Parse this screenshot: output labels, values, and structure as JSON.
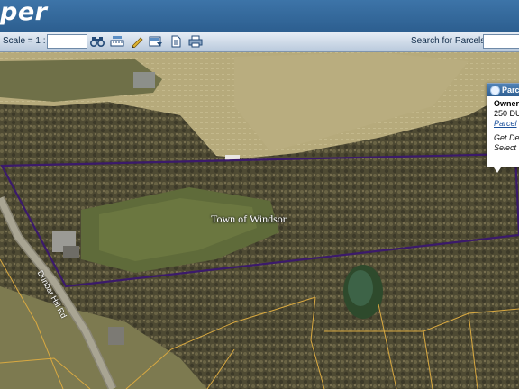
{
  "app": {
    "logo_text": "per"
  },
  "toolbar": {
    "scale_label": "Scale = 1 :",
    "scale_value": "",
    "search_label": "Search for Parcels",
    "search_value": "",
    "tools": [
      "binoculars-icon",
      "ruler-icon",
      "pencil-icon",
      "map-link-icon",
      "document-icon",
      "print-icon"
    ]
  },
  "popup": {
    "title": "Parce",
    "owner_label": "Owner",
    "address": "250 DU",
    "parcel_link": "Parcel",
    "get_details": "Get De",
    "select": "Select"
  },
  "map": {
    "municipality_label": "Town of Windsor",
    "road_label": "Dunbar Hill Rd",
    "selected_parcel_color": "#3b1a6b",
    "parcel_line_color": "#d9a941"
  }
}
